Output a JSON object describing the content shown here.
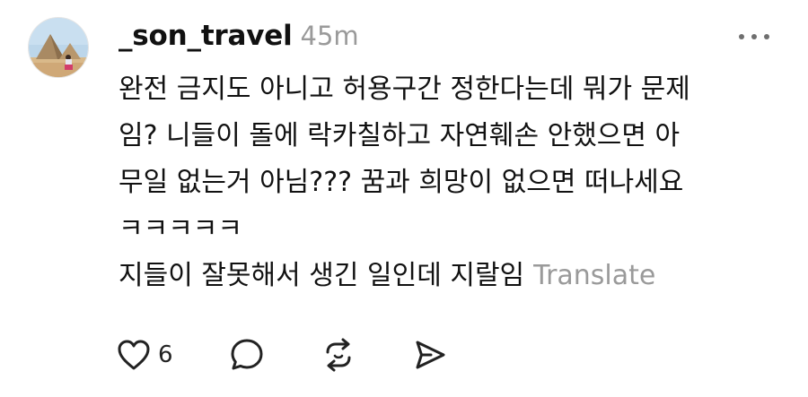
{
  "post": {
    "username": "_son_travel",
    "timestamp": "45m",
    "lines": [
      "완전 금지도 아니고 허용구간 정한다는데 뭐가 문제",
      "임? 니들이 돌에 락카칠하고 자연훼손 안했으면 아",
      "무일 없는거 아님??? 꿈과 희망이 없으면 떠나세요",
      "ㅋㅋㅋㅋㅋ",
      "지들이 잘못해서 생긴 일인데 지랄임"
    ],
    "translate_label": "Translate"
  },
  "actions": {
    "like_count": "6",
    "icons": [
      "heart-icon",
      "comment-icon",
      "repost-icon",
      "share-icon"
    ]
  },
  "menu_icon": "more-icon",
  "colors": {
    "text": "#111111",
    "muted": "#9a9a9a",
    "background": "#ffffff"
  }
}
